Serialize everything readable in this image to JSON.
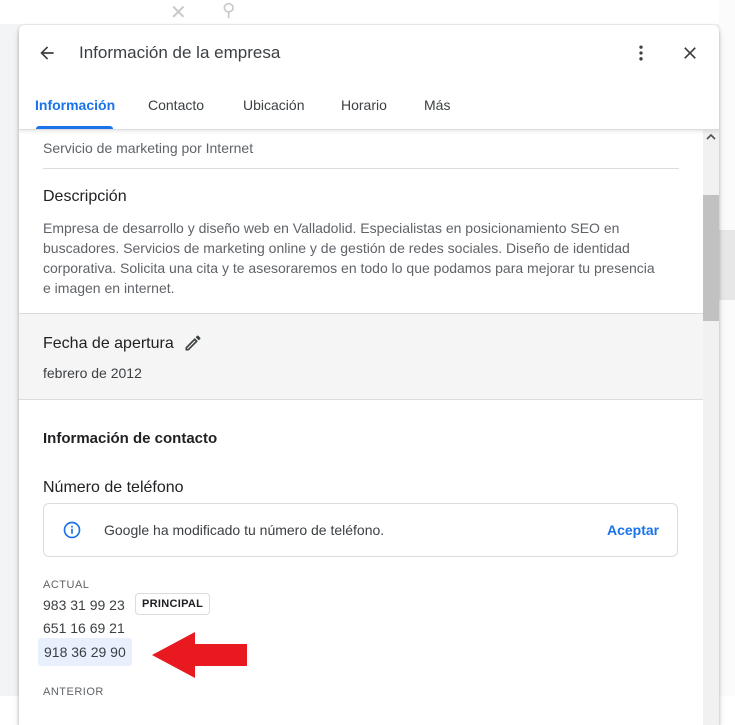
{
  "dialog": {
    "title": "Información de la empresa",
    "tabs": [
      "Información",
      "Contacto",
      "Ubicación",
      "Horario",
      "Más"
    ],
    "active_tab": "Información"
  },
  "content": {
    "category": "Servicio de marketing por Internet",
    "description": {
      "title": "Descripción",
      "text": "Empresa de desarrollo y diseño web en Valladolid. Especialistas en posicionamiento SEO en buscadores. Servicios de marketing online y de gestión de redes sociales. Diseño de identidad corporativa. Solicita una cita y te asesoraremos en todo lo que podamos para mejorar tu presencia e imagen en internet."
    },
    "opening_date": {
      "title": "Fecha de apertura",
      "value": "febrero de 2012"
    },
    "contact": {
      "section_title": "Información de contacto",
      "phone_title": "Número de teléfono",
      "notice_text": "Google ha modificado tu número de teléfono.",
      "notice_action": "Aceptar",
      "current_label": "ACTUAL",
      "primary_badge": "PRINCIPAL",
      "current_numbers": [
        "983 31 99 23",
        "651 16 69 21",
        "918 36 29 90"
      ],
      "previous_label": "ANTERIOR"
    }
  },
  "colors": {
    "accent": "#1a73e8",
    "highlight": "#e8f0fe",
    "arrow": "#e8191f"
  },
  "icons": {
    "back": "arrow-left-icon",
    "more": "more-vert-icon",
    "close": "close-icon",
    "edit": "pencil-icon",
    "info": "info-icon"
  }
}
